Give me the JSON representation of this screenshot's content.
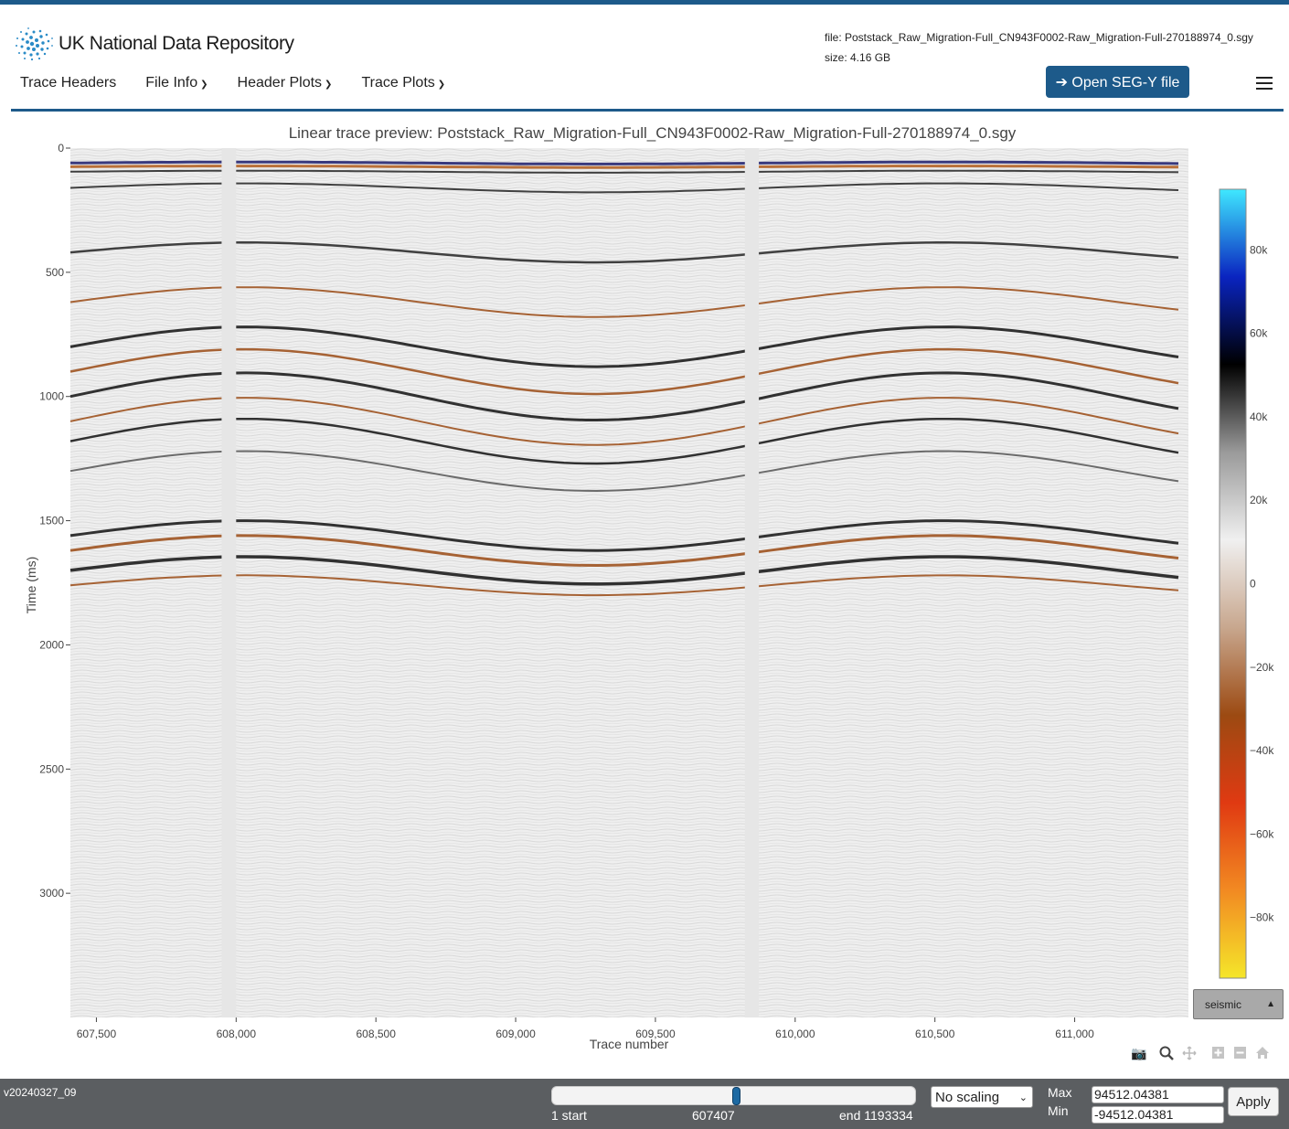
{
  "header": {
    "logo_text": "UK National Data Repository",
    "file_name": "file: Poststack_Raw_Migration-Full_CN943F0002-Raw_Migration-Full-270188974_0.sgy",
    "file_size": "size: 4.16 GB",
    "open_button": "➔ Open SEG-Y file"
  },
  "nav": {
    "items": [
      {
        "label": "Trace Headers",
        "dropdown": false
      },
      {
        "label": "File Info",
        "dropdown": true
      },
      {
        "label": "Header Plots",
        "dropdown": true
      },
      {
        "label": "Trace Plots",
        "dropdown": true
      }
    ]
  },
  "plot": {
    "title": "Linear trace preview: Poststack_Raw_Migration-Full_CN943F0002-Raw_Migration-Full-270188974_0.sgy",
    "colormap": "seismic"
  },
  "chart_data": {
    "type": "heatmap",
    "title": "Linear trace preview: Poststack_Raw_Migration-Full_CN943F0002-Raw_Migration-Full-270188974_0.sgy",
    "xlabel": "Trace number",
    "ylabel": "Time (ms)",
    "xlim": [
      607407,
      611407
    ],
    "ylim": [
      3500,
      0
    ],
    "x_ticks": [
      607500,
      608000,
      608500,
      609000,
      609500,
      610000,
      610500,
      611000
    ],
    "x_tick_labels": [
      "607,500",
      "608,000",
      "608,500",
      "609,000",
      "609,500",
      "610,000",
      "610,500",
      "611,000"
    ],
    "y_ticks": [
      0,
      500,
      1000,
      1500,
      2000,
      2500,
      3000
    ],
    "y_tick_labels": [
      "0",
      "500",
      "1000",
      "1500",
      "2000",
      "2500",
      "3000"
    ],
    "colorbar": {
      "zlim": [
        -94512.04381,
        94512.04381
      ],
      "ticks": [
        80000,
        60000,
        40000,
        20000,
        0,
        -20000,
        -40000,
        -60000,
        -80000
      ],
      "tick_labels": [
        "80k",
        "60k",
        "40k",
        "20k",
        "0",
        "−20k",
        "−40k",
        "−60k",
        "−80k"
      ],
      "colors": [
        "#f5e62a",
        "#f28a22",
        "#e03a12",
        "#9c4a12",
        "#c8a78e",
        "#f0f0f0",
        "#9a9a9a",
        "#000000",
        "#0a24c0",
        "#3fe8ff"
      ]
    }
  },
  "colors": {
    "brand": "#1d5a8a",
    "footer": "#5b5e61"
  },
  "modebar": {
    "icons": [
      "camera-icon",
      "zoom-icon",
      "pan-icon",
      "zoom-in-icon",
      "zoom-out-icon",
      "home-icon"
    ]
  },
  "footer": {
    "version": "v20240327_09",
    "slider": {
      "start_label": "1 start",
      "current": "607407",
      "end_label": "end 1193334",
      "position": 0.509
    },
    "scaling": "No scaling",
    "max_label": "Max",
    "min_label": "Min",
    "max_value": "94512.04381",
    "min_value": "-94512.04381",
    "apply": "Apply"
  }
}
